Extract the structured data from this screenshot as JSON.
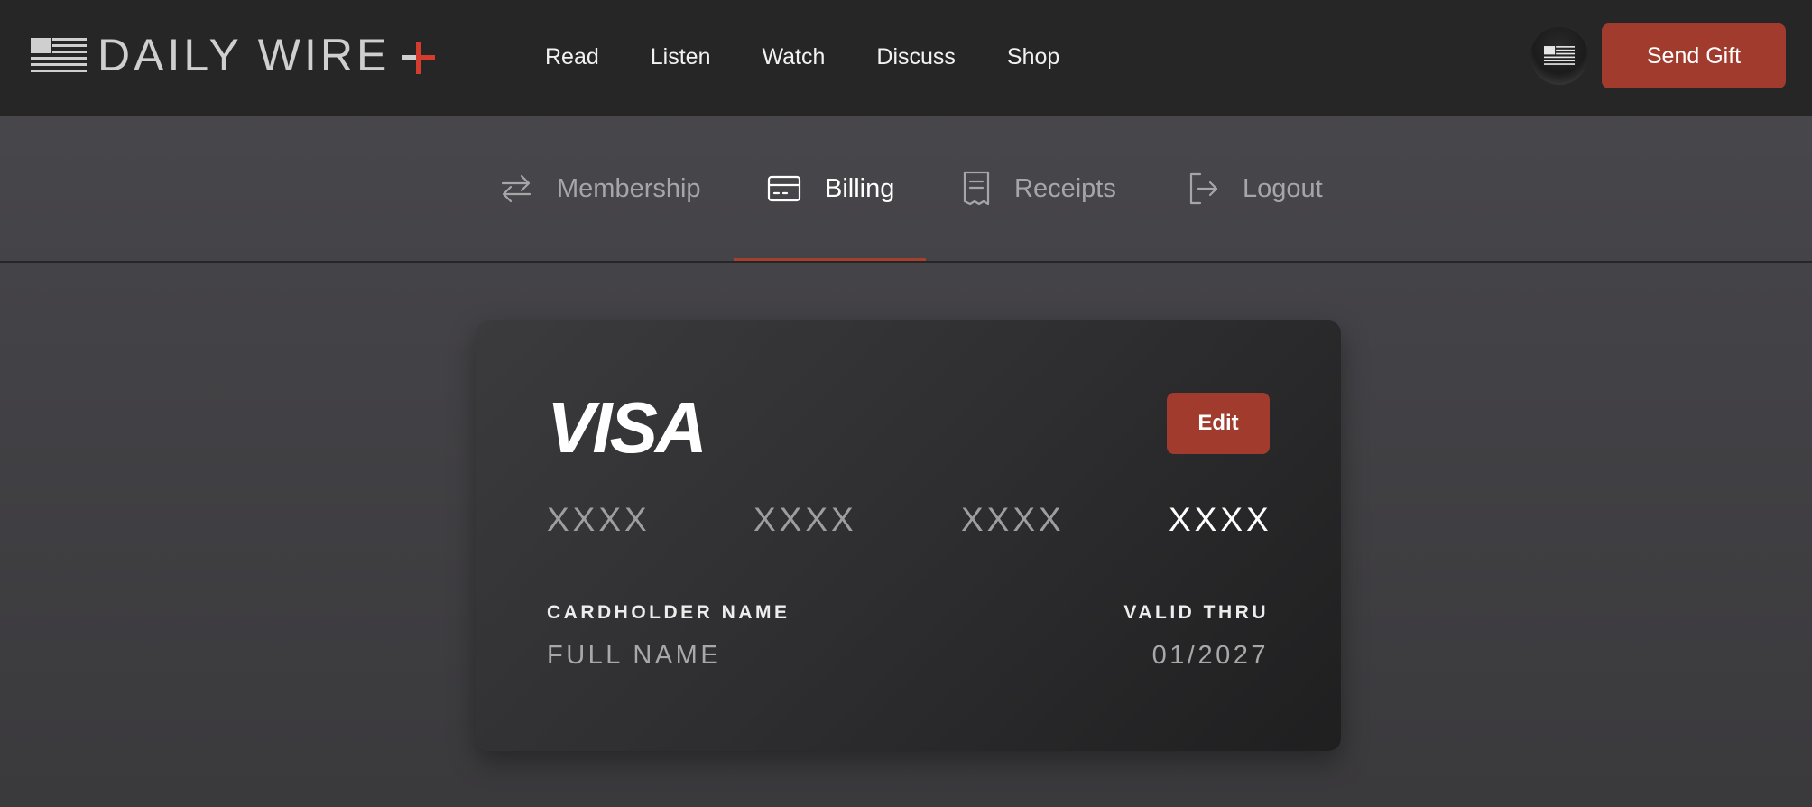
{
  "header": {
    "logo_text": "DAILY WIRE",
    "nav": [
      "Read",
      "Listen",
      "Watch",
      "Discuss",
      "Shop"
    ],
    "send_gift_label": "Send Gift"
  },
  "account_tabs": [
    {
      "label": "Membership",
      "icon": "arrows-swap-icon",
      "active": false
    },
    {
      "label": "Billing",
      "icon": "credit-card-icon",
      "active": true
    },
    {
      "label": "Receipts",
      "icon": "receipt-icon",
      "active": false
    },
    {
      "label": "Logout",
      "icon": "logout-icon",
      "active": false
    }
  ],
  "card": {
    "brand": "VISA",
    "edit_label": "Edit",
    "number_groups": [
      "XXXX",
      "XXXX",
      "XXXX",
      "XXXX"
    ],
    "cardholder_label": "CARDHOLDER NAME",
    "cardholder_value": "FULL NAME",
    "valid_thru_label": "VALID THRU",
    "valid_thru_value": "01/2027"
  },
  "colors": {
    "accent": "#a13b2e",
    "header_bg": "#262626"
  }
}
